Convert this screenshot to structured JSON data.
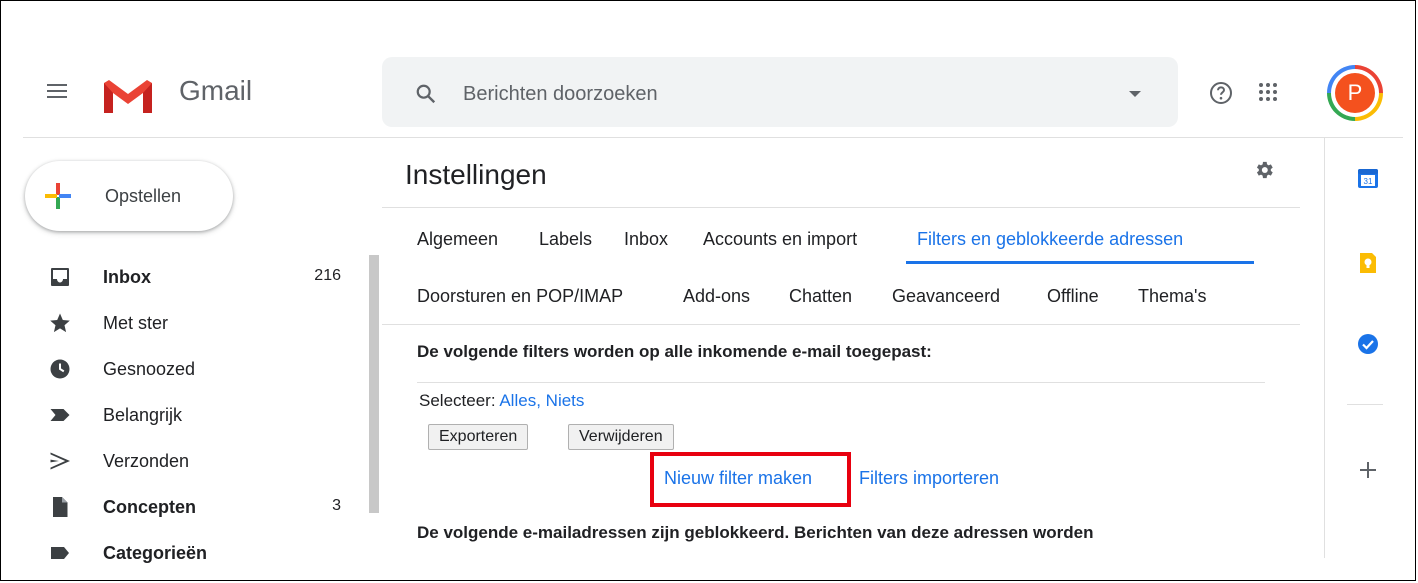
{
  "header": {
    "brand": "Gmail",
    "search_placeholder": "Berichten doorzoeken",
    "avatar_letter": "P"
  },
  "sidebar": {
    "compose_label": "Opstellen",
    "items": [
      {
        "label": "Inbox",
        "count": "216",
        "bold": true,
        "icon": "inbox-icon"
      },
      {
        "label": "Met ster",
        "count": "",
        "bold": false,
        "icon": "star-icon"
      },
      {
        "label": "Gesnoozed",
        "count": "",
        "bold": false,
        "icon": "clock-icon"
      },
      {
        "label": "Belangrijk",
        "count": "",
        "bold": false,
        "icon": "important-icon"
      },
      {
        "label": "Verzonden",
        "count": "",
        "bold": false,
        "icon": "send-icon"
      },
      {
        "label": "Concepten",
        "count": "3",
        "bold": true,
        "icon": "draft-icon"
      },
      {
        "label": "Categorieën",
        "count": "",
        "bold": true,
        "icon": "label-icon"
      }
    ]
  },
  "main": {
    "title": "Instellingen",
    "tabs_row1": [
      "Algemeen",
      "Labels",
      "Inbox",
      "Accounts en import",
      "Filters en geblokkeerde adressen"
    ],
    "tabs_row2": [
      "Doorsturen en POP/IMAP",
      "Add-ons",
      "Chatten",
      "Geavanceerd",
      "Offline",
      "Thema's"
    ],
    "active_tab": "Filters en geblokkeerde adressen",
    "filters_heading": "De volgende filters worden op alle inkomende e-mail toegepast:",
    "select_label": "Selecteer:",
    "select_all": "Alles",
    "select_comma": ",",
    "select_none": "Niets",
    "export_button": "Exporteren",
    "delete_button": "Verwijderen",
    "new_filter_link": "Nieuw filter maken",
    "import_filters_link": "Filters importeren",
    "blocked_heading": "De volgende e-mailadressen zijn geblokkeerd. Berichten van deze adressen worden"
  },
  "colors": {
    "accent": "#1a73e8",
    "highlight_box": "#e8000f",
    "avatar": "#f4511e"
  }
}
